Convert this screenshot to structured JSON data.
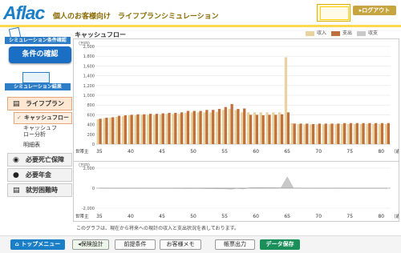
{
  "header": {
    "logo": "Aflac",
    "subtitle": "個人のお客様向け　ライフプランシミュレーション",
    "logout": "▸ログアウト"
  },
  "sidebar": {
    "condition_head": "シミュレーション条件確認",
    "condition_button": "条件の確認",
    "result_head": "シミュレーション結果",
    "items": [
      {
        "label": "ライフプラン",
        "icon": "book-icon",
        "selected": true
      },
      {
        "label": "必要死亡保障",
        "icon": "coins-icon"
      },
      {
        "label": "必要年金",
        "icon": "pig-icon"
      },
      {
        "label": "就労困難時",
        "icon": "book-icon"
      }
    ],
    "subitems": [
      {
        "label": "キャッシュフロー",
        "selected": true
      },
      {
        "label": "キャッシュフロー分析"
      },
      {
        "label": "明細表"
      }
    ]
  },
  "chart_title": "キャッシュフロー",
  "legend": [
    {
      "label": "収入",
      "color": "#e8d3a0"
    },
    {
      "label": "支出",
      "color": "#c0703a"
    },
    {
      "label": "収支",
      "color": "#c8c8c8"
    }
  ],
  "note": "このグラフは、現在から将来への現計の収入と支出状況を表しております。",
  "footer": {
    "buttons": [
      "トップメニュー",
      "保険設計",
      "前提条件",
      "お客様メモ",
      "帳票出力",
      "データ保存"
    ]
  },
  "chart_data": [
    {
      "type": "bar",
      "unit": "（万円）",
      "xlabel": "（歳）",
      "age_label": "世帯主",
      "ylim": [
        0,
        2000
      ],
      "yticks": [
        "2,000",
        "1,800",
        "1,600",
        "1,400",
        "1,200",
        "1,000",
        "800",
        "600",
        "400",
        "200",
        "0"
      ],
      "xticks": [
        35,
        40,
        45,
        50,
        55,
        60,
        65,
        70,
        75,
        80
      ],
      "x": [
        35,
        36,
        37,
        38,
        39,
        40,
        41,
        42,
        43,
        44,
        45,
        46,
        47,
        48,
        49,
        50,
        51,
        52,
        53,
        54,
        55,
        56,
        57,
        58,
        59,
        60,
        61,
        62,
        63,
        64,
        65,
        66,
        67,
        68,
        69,
        70,
        71,
        72,
        73,
        74,
        75,
        76,
        77,
        78,
        79,
        80,
        81
      ],
      "series": [
        {
          "name": "収入",
          "values": [
            510,
            530,
            540,
            560,
            570,
            590,
            590,
            600,
            600,
            600,
            610,
            620,
            620,
            620,
            640,
            650,
            650,
            650,
            650,
            660,
            700,
            720,
            700,
            650,
            650,
            650,
            650,
            650,
            650,
            650,
            1780,
            430,
            410,
            400,
            400,
            400,
            400,
            410,
            410,
            410,
            410,
            410,
            410,
            410,
            410,
            410,
            410
          ]
        },
        {
          "name": "支出",
          "values": [
            520,
            540,
            550,
            580,
            590,
            600,
            610,
            610,
            620,
            620,
            630,
            640,
            640,
            650,
            680,
            680,
            680,
            700,
            700,
            720,
            760,
            820,
            720,
            730,
            600,
            600,
            590,
            600,
            600,
            610,
            650,
            420,
            420,
            420,
            410,
            420,
            420,
            420,
            420,
            430,
            430,
            430,
            430,
            430,
            430,
            430,
            430
          ]
        }
      ]
    },
    {
      "type": "area",
      "unit": "（万円）",
      "xlabel": "（歳）",
      "age_label": "世帯主",
      "ylim": [
        -2000,
        2000
      ],
      "yticks": [
        "2,000",
        "0",
        "-2,000"
      ],
      "xticks": [
        35,
        40,
        45,
        50,
        55,
        60,
        65,
        70,
        75,
        80
      ],
      "x": [
        35,
        36,
        37,
        38,
        39,
        40,
        41,
        42,
        43,
        44,
        45,
        46,
        47,
        48,
        49,
        50,
        51,
        52,
        53,
        54,
        55,
        56,
        57,
        58,
        59,
        60,
        61,
        62,
        63,
        64,
        65,
        66,
        67,
        68,
        69,
        70,
        71,
        72,
        73,
        74,
        75,
        76,
        77,
        78,
        79,
        80,
        81
      ],
      "series": [
        {
          "name": "収支",
          "values": [
            -10,
            -10,
            -10,
            -20,
            -20,
            -10,
            -20,
            -10,
            -20,
            -20,
            -20,
            -20,
            -20,
            -30,
            -40,
            -30,
            -30,
            -50,
            -50,
            -60,
            -60,
            -100,
            -20,
            -80,
            50,
            50,
            60,
            50,
            50,
            40,
            1130,
            10,
            -10,
            -20,
            -10,
            -20,
            -20,
            -10,
            -10,
            -20,
            -20,
            -20,
            -20,
            -20,
            -20,
            -20,
            -20
          ]
        }
      ]
    }
  ]
}
